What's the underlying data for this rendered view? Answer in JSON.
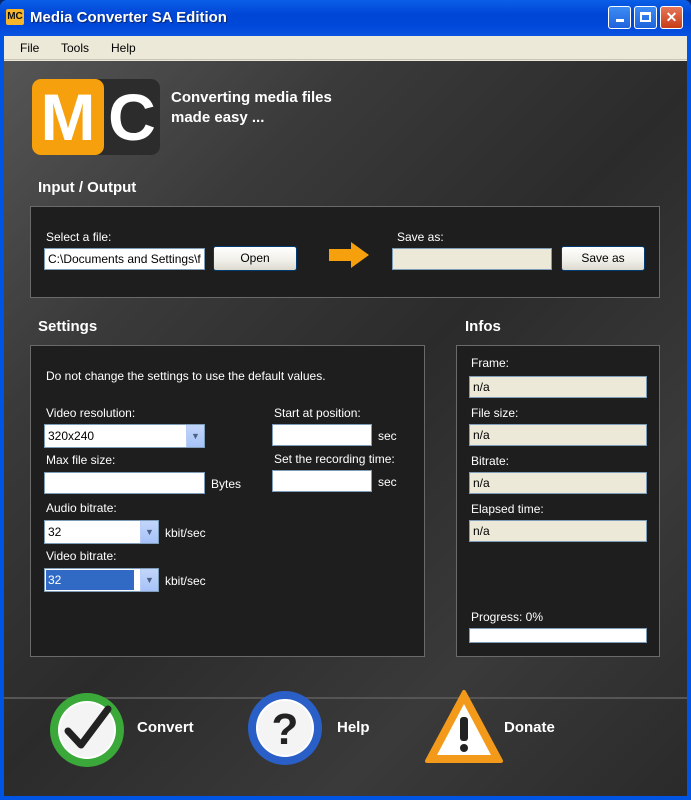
{
  "window": {
    "title": "Media Converter SA Edition",
    "icon_text": "MC",
    "controls": [
      "minimize",
      "maximize",
      "close"
    ]
  },
  "menu": [
    "File",
    "Tools",
    "Help"
  ],
  "logo": {
    "m": "M",
    "c": "C"
  },
  "tagline": [
    "Converting media files",
    "made easy ..."
  ],
  "io": {
    "title": "Input / Output",
    "select_label": "Select a file:",
    "file_value": "C:\\Documents and Settings\\f",
    "open_button": "Open",
    "save_label": "Save as:",
    "save_value": "",
    "save_button": "Save as"
  },
  "settings": {
    "title": "Settings",
    "hint": "Do not change the settings to use the default values.",
    "video_resolution_label": "Video resolution:",
    "video_resolution_value": "320x240",
    "max_file_size_label": "Max file size:",
    "max_file_size_value": "",
    "max_file_size_unit": "Bytes",
    "audio_bitrate_label": "Audio bitrate:",
    "audio_bitrate_value": "32",
    "audio_bitrate_unit": "kbit/sec",
    "video_bitrate_label": "Video bitrate:",
    "video_bitrate_value": "32",
    "video_bitrate_unit": "kbit/sec",
    "start_label": "Start at position:",
    "start_value": "",
    "start_unit": "sec",
    "rec_label": "Set the recording time:",
    "rec_value": "",
    "rec_unit": "sec"
  },
  "infos": {
    "title": "Infos",
    "frame_label": "Frame:",
    "frame_value": "n/a",
    "filesize_label": "File size:",
    "filesize_value": "n/a",
    "bitrate_label": "Bitrate:",
    "bitrate_value": "n/a",
    "elapsed_label": "Elapsed time:",
    "elapsed_value": "n/a",
    "progress_label": "Progress: 0%",
    "progress": 0
  },
  "actions": {
    "convert": "Convert",
    "help": "Help",
    "donate": "Donate"
  },
  "colors": {
    "accent": "#f6a00e",
    "title_bar": "#0054e3",
    "panel": "#1e1e1e",
    "convert_green": "#3aa93a",
    "help_blue": "#2a5fc8",
    "donate_orange": "#f39a1a"
  }
}
